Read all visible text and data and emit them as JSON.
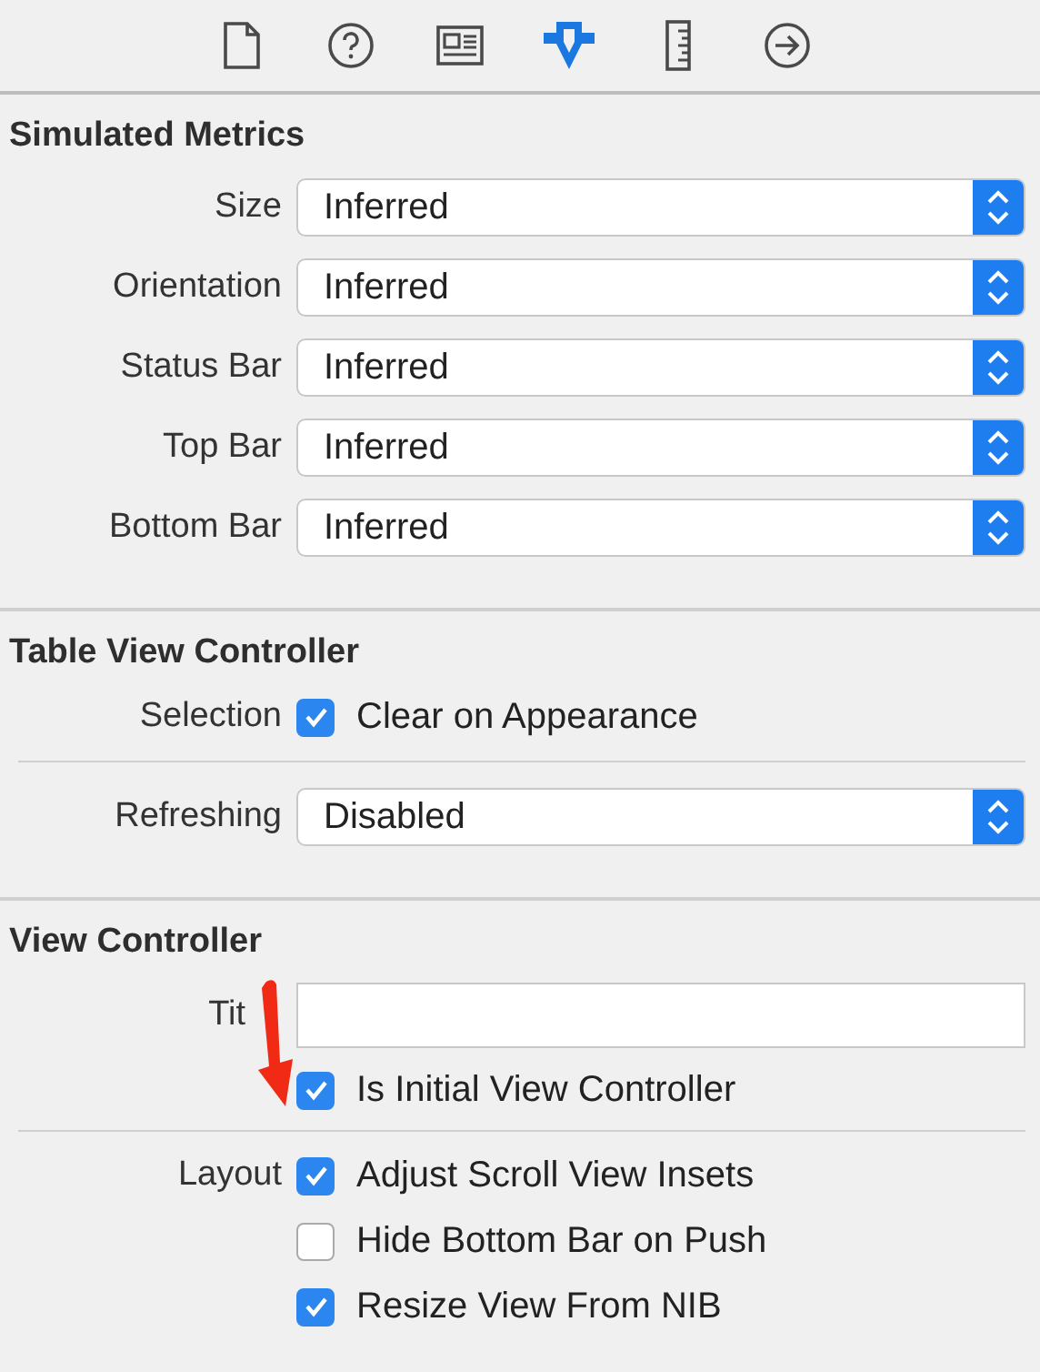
{
  "toolbar": [
    {
      "kind": "file",
      "selected": false
    },
    {
      "kind": "help",
      "selected": false
    },
    {
      "kind": "identity",
      "selected": false
    },
    {
      "kind": "attributes",
      "selected": true
    },
    {
      "kind": "size",
      "selected": false
    },
    {
      "kind": "connections",
      "selected": false
    }
  ],
  "sections": [
    {
      "title": "Simulated Metrics",
      "rows": [
        {
          "kind": "select",
          "label": "Size",
          "value": "Inferred"
        },
        {
          "kind": "select",
          "label": "Orientation",
          "value": "Inferred"
        },
        {
          "kind": "select",
          "label": "Status Bar",
          "value": "Inferred"
        },
        {
          "kind": "select",
          "label": "Top Bar",
          "value": "Inferred"
        },
        {
          "kind": "select",
          "label": "Bottom Bar",
          "value": "Inferred"
        }
      ]
    },
    {
      "title": "Table View Controller",
      "rows": [
        {
          "kind": "checkbox",
          "label": "Selection",
          "text": "Clear on Appearance",
          "checked": true
        },
        {
          "kind": "divider"
        },
        {
          "kind": "select",
          "label": "Refreshing",
          "value": "Disabled"
        }
      ]
    },
    {
      "title": "View Controller",
      "rows": [
        {
          "kind": "text",
          "label": "Tit"
        },
        {
          "kind": "checkbox",
          "text": "Is Initial View Controller",
          "checked": true
        },
        {
          "kind": "divider"
        },
        {
          "kind": "checkbox",
          "label": "Layout",
          "text": "Adjust Scroll View Insets",
          "checked": true
        },
        {
          "kind": "checkbox",
          "text": "Hide Bottom Bar on Push",
          "checked": false
        },
        {
          "kind": "checkbox",
          "text": "Resize View From NIB",
          "checked": true
        }
      ]
    }
  ]
}
